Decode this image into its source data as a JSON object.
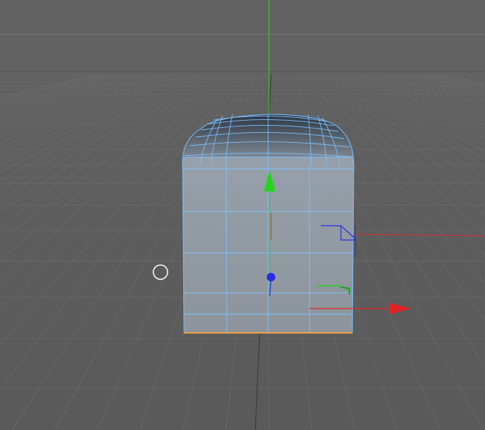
{
  "app": {
    "kind": "3d-viewport",
    "view": "perspective"
  },
  "colors": {
    "background": "#5e5e5e",
    "grid": "#6a6a6a",
    "horizon": "#727272",
    "world_axis_y": "#2ec43a",
    "world_axis_x": "#d83030",
    "selection_wire": "#7ec1ff",
    "object_fill": "#8c959f",
    "bottom_edge": "#f0a040",
    "gizmo_y": "#24d41c",
    "gizmo_x": "#e02424",
    "gizmo_z": "#2a2ae8",
    "cursor_ring": "#ffffff"
  },
  "icons": {
    "move_y": "arrow-up-icon",
    "move_x": "arrow-right-icon",
    "move_z": "dot-icon",
    "cursor": "circle-cursor-icon"
  },
  "scene": {
    "object_type": "rounded-box",
    "selected": true,
    "show_grid": true,
    "active_tool": "move"
  }
}
